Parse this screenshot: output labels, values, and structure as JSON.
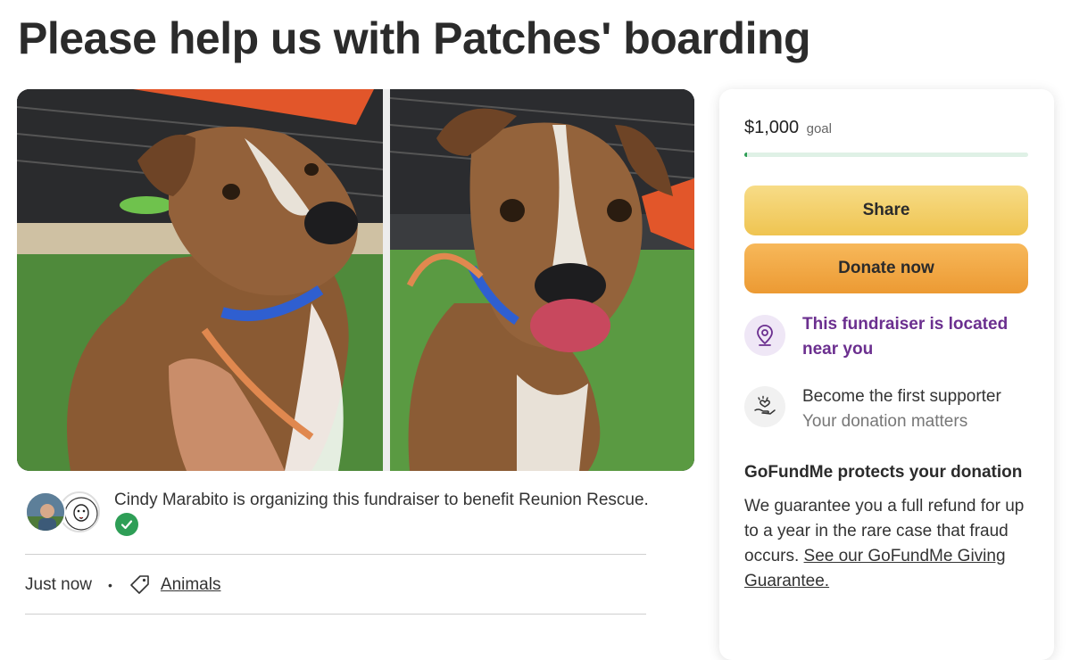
{
  "title": "Please help us with Patches' boarding",
  "organizer": {
    "text": "Cindy Marabito is organizing this fundraiser to benefit Reunion Rescue."
  },
  "meta": {
    "time": "Just now",
    "separator": "•",
    "category": "Animals"
  },
  "donation_card": {
    "goal_amount": "$1,000",
    "goal_label": "goal",
    "progress_fraction": 0.01,
    "share_label": "Share",
    "donate_label": "Donate now",
    "location_text": "This fundraiser is located near you",
    "supporter_title": "Become the first supporter",
    "supporter_subtitle": "Your donation matters",
    "protect_heading": "GoFundMe protects your donation",
    "protect_body": "We guarantee you a full refund for up to a year in the rare case that fraud occurs.",
    "protect_link": "See our GoFundMe Giving Guarantee."
  },
  "colors": {
    "share_button": "#efc451",
    "donate_button": "#ec9a33",
    "location_text": "#6b2f8f",
    "verified_badge": "#2e9e56",
    "progress_track": "#dff1e6"
  },
  "icons": {
    "verified": "check-circle-icon",
    "category": "tag-icon",
    "location": "map-pin-icon",
    "supporter": "hand-heart-icon"
  }
}
